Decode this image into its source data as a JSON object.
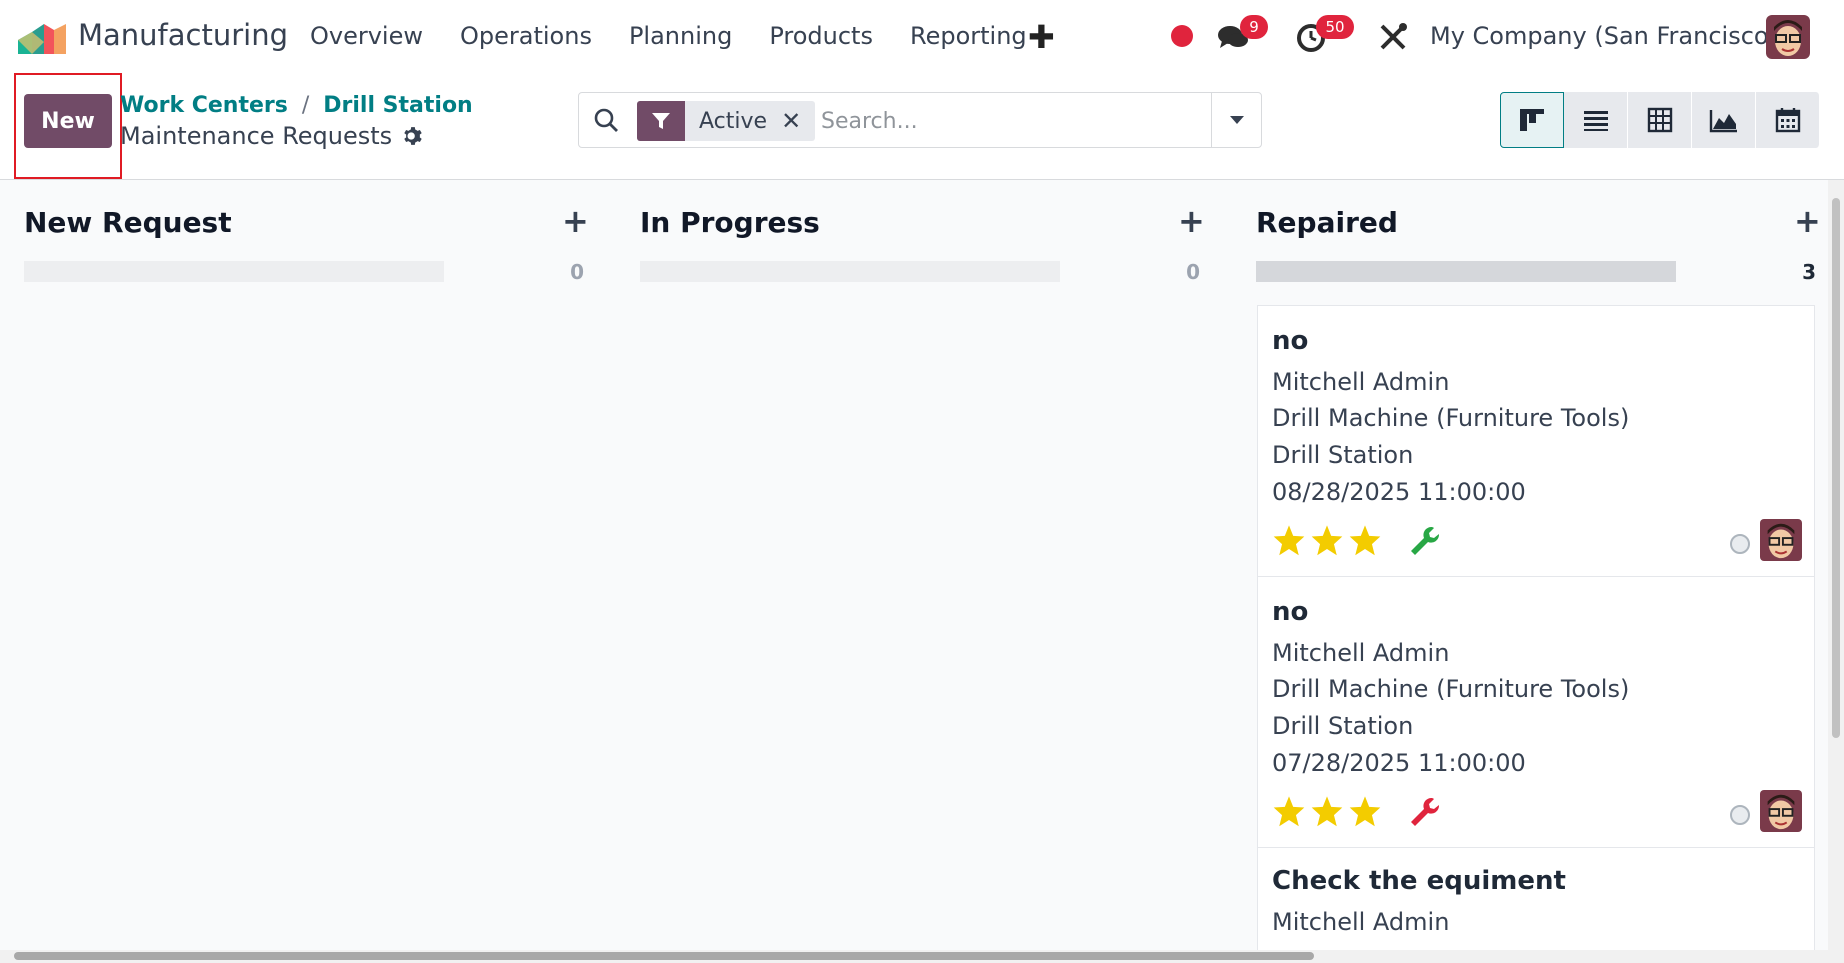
{
  "app": {
    "name": "Manufacturing"
  },
  "menu": [
    "Overview",
    "Operations",
    "Planning",
    "Products",
    "Reporting"
  ],
  "systray": {
    "messages_badge": "9",
    "activities_badge": "50",
    "company": "My Company (San Francisco)"
  },
  "controls": {
    "new_label": "New",
    "breadcrumb": [
      "Work Centers",
      "Drill Station"
    ],
    "breadcrumb_sep": "/",
    "page_title": "Maintenance Requests",
    "facet_label": "Active",
    "search_placeholder": "Search..."
  },
  "columns": [
    {
      "title": "New Request",
      "count": "0",
      "fill": 0
    },
    {
      "title": "In Progress",
      "count": "0",
      "fill": 0
    },
    {
      "title": "Repaired",
      "count": "3",
      "fill": 1
    }
  ],
  "cards": [
    {
      "title": "no",
      "user": "Mitchell Admin",
      "equipment": "Drill Machine (Furniture Tools)",
      "workcenter": "Drill Station",
      "date": "08/28/2025 11:00:00",
      "stars": 3,
      "wrench_color": "#28a745"
    },
    {
      "title": "no",
      "user": "Mitchell Admin",
      "equipment": "Drill Machine (Furniture Tools)",
      "workcenter": "Drill Station",
      "date": "07/28/2025 11:00:00",
      "stars": 3,
      "wrench_color": "#e0243d"
    },
    {
      "title": "Check the equiment",
      "user": "Mitchell Admin"
    }
  ],
  "colors": {
    "brand": "#714b67",
    "link": "#017e84",
    "badge": "#e0243d",
    "star": "#f3cc00"
  }
}
